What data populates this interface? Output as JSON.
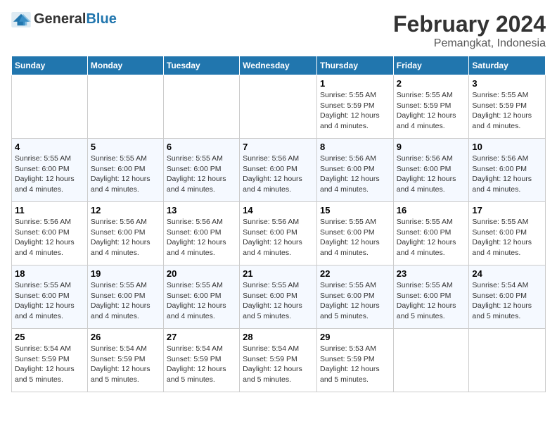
{
  "header": {
    "logo": {
      "general": "General",
      "blue": "Blue"
    },
    "month": "February 2024",
    "location": "Pemangkat, Indonesia"
  },
  "weekdays": [
    "Sunday",
    "Monday",
    "Tuesday",
    "Wednesday",
    "Thursday",
    "Friday",
    "Saturday"
  ],
  "weeks": [
    [
      {
        "day": "",
        "empty": true
      },
      {
        "day": "",
        "empty": true
      },
      {
        "day": "",
        "empty": true
      },
      {
        "day": "",
        "empty": true
      },
      {
        "day": "1",
        "sunrise": "5:55 AM",
        "sunset": "5:59 PM",
        "daylight": "12 hours and 4 minutes."
      },
      {
        "day": "2",
        "sunrise": "5:55 AM",
        "sunset": "5:59 PM",
        "daylight": "12 hours and 4 minutes."
      },
      {
        "day": "3",
        "sunrise": "5:55 AM",
        "sunset": "5:59 PM",
        "daylight": "12 hours and 4 minutes."
      }
    ],
    [
      {
        "day": "4",
        "sunrise": "5:55 AM",
        "sunset": "6:00 PM",
        "daylight": "12 hours and 4 minutes."
      },
      {
        "day": "5",
        "sunrise": "5:55 AM",
        "sunset": "6:00 PM",
        "daylight": "12 hours and 4 minutes."
      },
      {
        "day": "6",
        "sunrise": "5:55 AM",
        "sunset": "6:00 PM",
        "daylight": "12 hours and 4 minutes."
      },
      {
        "day": "7",
        "sunrise": "5:56 AM",
        "sunset": "6:00 PM",
        "daylight": "12 hours and 4 minutes."
      },
      {
        "day": "8",
        "sunrise": "5:56 AM",
        "sunset": "6:00 PM",
        "daylight": "12 hours and 4 minutes."
      },
      {
        "day": "9",
        "sunrise": "5:56 AM",
        "sunset": "6:00 PM",
        "daylight": "12 hours and 4 minutes."
      },
      {
        "day": "10",
        "sunrise": "5:56 AM",
        "sunset": "6:00 PM",
        "daylight": "12 hours and 4 minutes."
      }
    ],
    [
      {
        "day": "11",
        "sunrise": "5:56 AM",
        "sunset": "6:00 PM",
        "daylight": "12 hours and 4 minutes."
      },
      {
        "day": "12",
        "sunrise": "5:56 AM",
        "sunset": "6:00 PM",
        "daylight": "12 hours and 4 minutes."
      },
      {
        "day": "13",
        "sunrise": "5:56 AM",
        "sunset": "6:00 PM",
        "daylight": "12 hours and 4 minutes."
      },
      {
        "day": "14",
        "sunrise": "5:56 AM",
        "sunset": "6:00 PM",
        "daylight": "12 hours and 4 minutes."
      },
      {
        "day": "15",
        "sunrise": "5:55 AM",
        "sunset": "6:00 PM",
        "daylight": "12 hours and 4 minutes."
      },
      {
        "day": "16",
        "sunrise": "5:55 AM",
        "sunset": "6:00 PM",
        "daylight": "12 hours and 4 minutes."
      },
      {
        "day": "17",
        "sunrise": "5:55 AM",
        "sunset": "6:00 PM",
        "daylight": "12 hours and 4 minutes."
      }
    ],
    [
      {
        "day": "18",
        "sunrise": "5:55 AM",
        "sunset": "6:00 PM",
        "daylight": "12 hours and 4 minutes."
      },
      {
        "day": "19",
        "sunrise": "5:55 AM",
        "sunset": "6:00 PM",
        "daylight": "12 hours and 4 minutes."
      },
      {
        "day": "20",
        "sunrise": "5:55 AM",
        "sunset": "6:00 PM",
        "daylight": "12 hours and 4 minutes."
      },
      {
        "day": "21",
        "sunrise": "5:55 AM",
        "sunset": "6:00 PM",
        "daylight": "12 hours and 5 minutes."
      },
      {
        "day": "22",
        "sunrise": "5:55 AM",
        "sunset": "6:00 PM",
        "daylight": "12 hours and 5 minutes."
      },
      {
        "day": "23",
        "sunrise": "5:55 AM",
        "sunset": "6:00 PM",
        "daylight": "12 hours and 5 minutes."
      },
      {
        "day": "24",
        "sunrise": "5:54 AM",
        "sunset": "6:00 PM",
        "daylight": "12 hours and 5 minutes."
      }
    ],
    [
      {
        "day": "25",
        "sunrise": "5:54 AM",
        "sunset": "5:59 PM",
        "daylight": "12 hours and 5 minutes."
      },
      {
        "day": "26",
        "sunrise": "5:54 AM",
        "sunset": "5:59 PM",
        "daylight": "12 hours and 5 minutes."
      },
      {
        "day": "27",
        "sunrise": "5:54 AM",
        "sunset": "5:59 PM",
        "daylight": "12 hours and 5 minutes."
      },
      {
        "day": "28",
        "sunrise": "5:54 AM",
        "sunset": "5:59 PM",
        "daylight": "12 hours and 5 minutes."
      },
      {
        "day": "29",
        "sunrise": "5:53 AM",
        "sunset": "5:59 PM",
        "daylight": "12 hours and 5 minutes."
      },
      {
        "day": "",
        "empty": true
      },
      {
        "day": "",
        "empty": true
      }
    ]
  ]
}
